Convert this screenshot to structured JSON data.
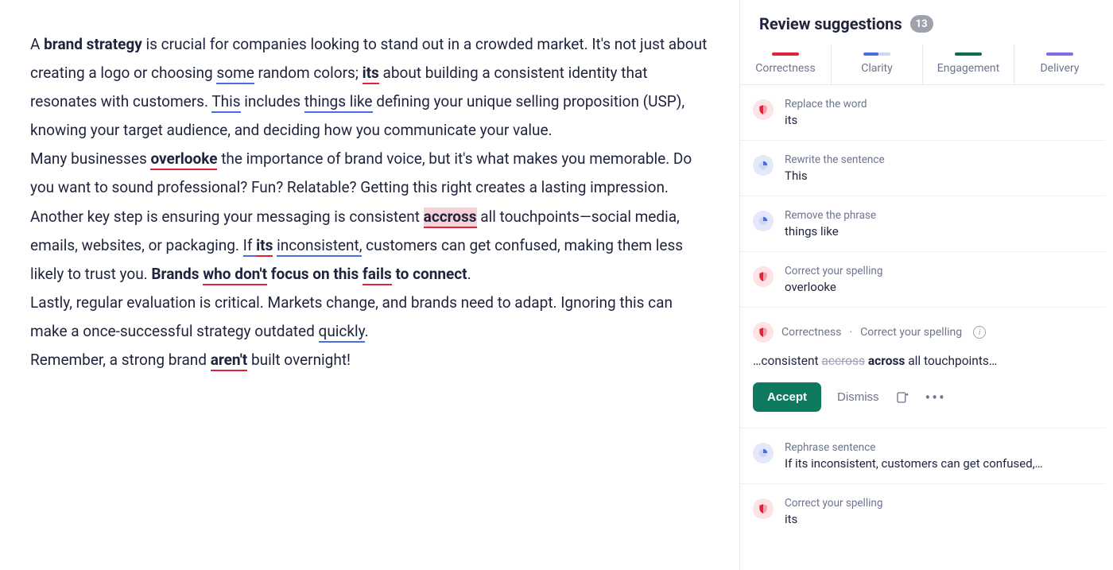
{
  "editor": {
    "p1": {
      "t0": "A ",
      "bold1": "brand strategy",
      "t1": " is crucial for companies looking to stand out in a crowded market. It's not just about creating a logo or choosing ",
      "u_some": "some",
      "t2": " random colors; ",
      "err_its": "its",
      "t3": " about building a consistent identity that resonates with customers. ",
      "u_this": "This",
      "t4": " includes ",
      "u_things": "things like",
      "t5": " defining your unique selling proposition (USP), knowing your target audience, and deciding how you communicate your value."
    },
    "p2": {
      "t0": "Many businesses ",
      "err_overlooke": "overlooke",
      "t1": " the importance of brand voice, but it's what makes you memorable. Do you want to sound professional? Fun? Relatable? Getting this right creates a lasting impression."
    },
    "p3": {
      "t0": "Another key step is ensuring your messaging is consistent ",
      "err_accross": "accross",
      "t1": " all touchpoints—social media, emails, websites, or packaging. ",
      "u_ifits_pre": "If ",
      "u_ifits_bold": "its",
      "u_ifits_red": " ",
      "u_incons": "inconsistent,",
      "t2": " customers can get confused, making them less likely to trust you. ",
      "bold_brands": "Brands ",
      "err_whodont": "who don't",
      "bold_focus": " focus on this ",
      "err_fails": "fails",
      "bold_end": " to connect",
      "period": "."
    },
    "p4": {
      "t0": "Lastly, regular evaluation is critical. Markets change, and brands need to adapt. Ignoring this can make a once-successful strategy outdated ",
      "u_quickly": "quickly",
      "period": "."
    },
    "p5": {
      "t0": "Remember, a strong brand ",
      "err_arent": "aren't",
      "t1": " built overnight!"
    }
  },
  "sidebar": {
    "title": "Review suggestions",
    "count": "13",
    "tabs": {
      "correctness": "Correctness",
      "clarity": "Clarity",
      "engagement": "Engagement",
      "delivery": "Delivery"
    },
    "items": [
      {
        "category": "correctness",
        "title": "Replace the word",
        "word": "its"
      },
      {
        "category": "clarity",
        "title": "Rewrite the sentence",
        "word": "This"
      },
      {
        "category": "clarity",
        "title": "Remove the phrase",
        "word": "things like"
      },
      {
        "category": "correctness",
        "title": "Correct your spelling",
        "word": "overlooke"
      }
    ],
    "expanded": {
      "category_label": "Correctness",
      "sep": " · ",
      "title": "Correct your spelling",
      "before": "…consistent ",
      "strike": "accross",
      "suggestion": " across",
      "after": " all touchpoints…",
      "accept": "Accept",
      "dismiss": "Dismiss"
    },
    "after": [
      {
        "category": "clarity",
        "title": "Rephrase sentence",
        "word": "If its inconsistent, customers can get confused,…"
      },
      {
        "category": "correctness",
        "title": "Correct your spelling",
        "word": "its"
      }
    ]
  }
}
